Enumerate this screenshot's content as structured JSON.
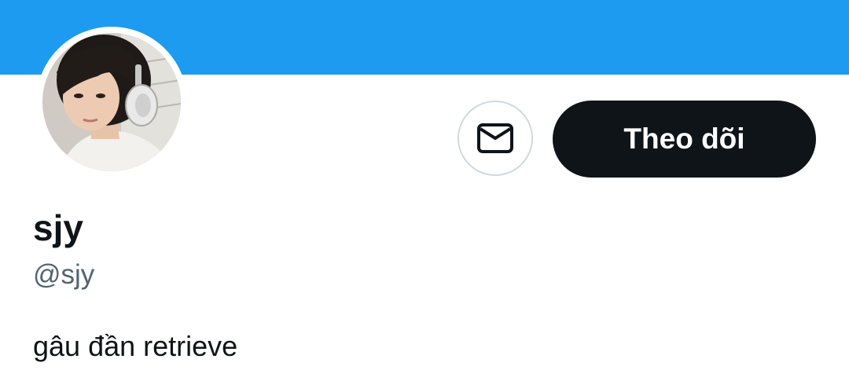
{
  "colors": {
    "banner": "#1d9bf0",
    "primary_text": "#0f1419",
    "secondary_text": "#536471",
    "follow_button_bg": "#0f1419",
    "follow_button_text": "#ffffff",
    "outline": "#cfd9de"
  },
  "profile": {
    "display_name": "sjy",
    "handle": "@sjy",
    "bio": "gâu đần retrieve",
    "avatar_icon": "profile-photo"
  },
  "actions": {
    "message_icon": "envelope-icon",
    "follow_label": "Theo dõi"
  }
}
